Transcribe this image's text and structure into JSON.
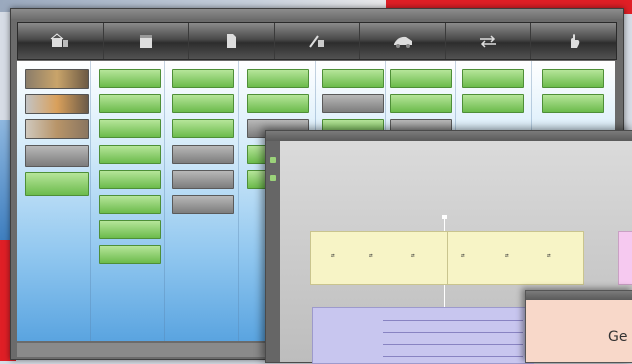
{
  "desktop": {},
  "main_window": {
    "toolbar": {
      "buttons": [
        "home-icon",
        "calendar-icon",
        "document-icon",
        "tools-icon",
        "vehicle-icon",
        "exchange-icon",
        "hand-icon"
      ]
    }
  },
  "second_window": {
    "yellow_pairs": [
      "→\n←",
      "→\n←",
      "→\n←",
      "→\n←",
      "→\n←",
      "→\n←"
    ]
  },
  "third_window": {
    "text": "Ge"
  }
}
